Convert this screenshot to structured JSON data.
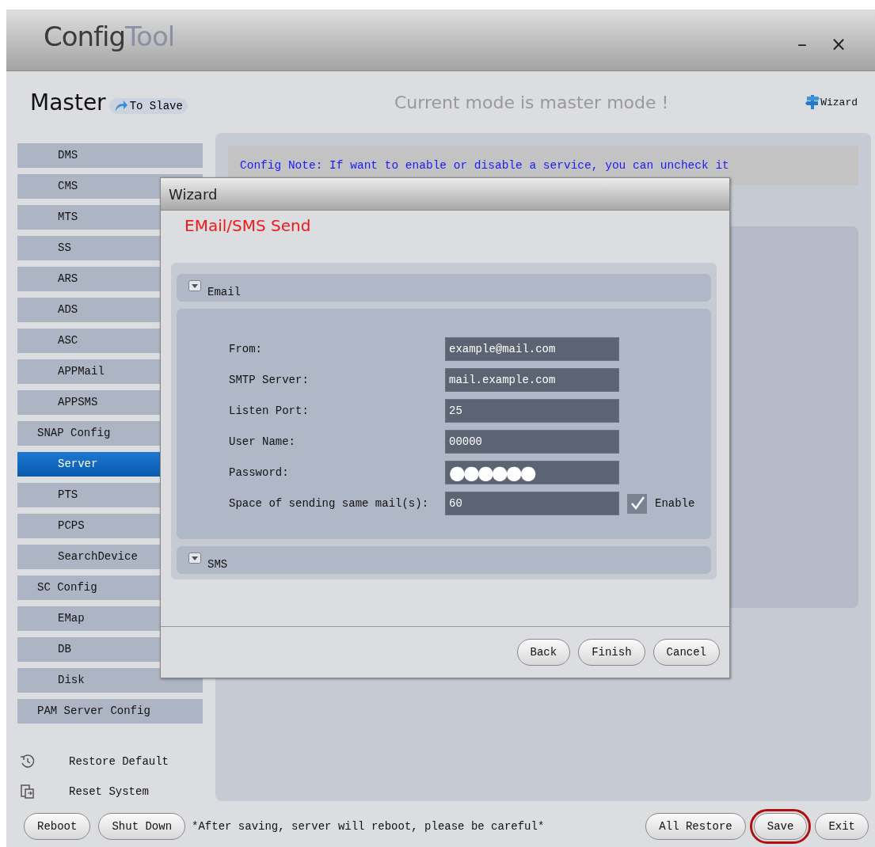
{
  "window": {
    "title_main": "Config",
    "title_accent": "Tool",
    "controls": [
      "–",
      "×"
    ]
  },
  "header": {
    "mode": "Master",
    "switch_button": "To Slave",
    "message": "Current mode is master mode !",
    "wizard_link": "Wizard"
  },
  "sidebar": {
    "groups": [
      {
        "children": [
          {
            "label": "DMS",
            "selected": false
          },
          {
            "label": "CMS",
            "selected": false
          },
          {
            "label": "MTS",
            "selected": false
          },
          {
            "label": "SS",
            "selected": false
          },
          {
            "label": "ARS",
            "selected": false
          },
          {
            "label": "ADS",
            "selected": false
          },
          {
            "label": "ASC",
            "selected": false
          },
          {
            "label": "APPMail",
            "selected": false
          },
          {
            "label": "APPSMS",
            "selected": false
          }
        ]
      },
      {
        "label": "SNAP Config",
        "children": [
          {
            "label": "Server",
            "selected": true
          },
          {
            "label": "PTS",
            "selected": false
          },
          {
            "label": "PCPS",
            "selected": false
          },
          {
            "label": "SearchDevice",
            "selected": false
          }
        ]
      },
      {
        "label": "SC Config",
        "children": [
          {
            "label": "EMap",
            "selected": false
          },
          {
            "label": "DB",
            "selected": false
          },
          {
            "label": "Disk",
            "selected": false
          }
        ]
      },
      {
        "label": "PAM Server Config"
      }
    ],
    "actions": [
      {
        "kind": "restore",
        "label": "Restore Default"
      },
      {
        "kind": "reset",
        "label": "Reset System"
      }
    ]
  },
  "main": {
    "note": "Config Note: If want to enable or disable a service, you can uncheck it"
  },
  "dialog": {
    "title": "Wizard",
    "heading": "EMail/SMS Send",
    "sections": [
      {
        "title": "Email",
        "fields": [
          {
            "label": "From:",
            "value": "example@mail.com",
            "kind": "text"
          },
          {
            "label": "SMTP Server:",
            "value": "mail.example.com",
            "kind": "text"
          },
          {
            "label": "Listen Port:",
            "value": "25",
            "kind": "text"
          },
          {
            "label": "User Name:",
            "value": "00000",
            "kind": "text"
          },
          {
            "label": "Password:",
            "value": "●●●●●●",
            "kind": "password"
          },
          {
            "label": "Space of sending same mail(s):",
            "value": "60",
            "kind": "text",
            "checkbox": {
              "label": "Enable",
              "checked": true
            }
          }
        ]
      },
      {
        "title": "SMS"
      }
    ],
    "buttons": [
      "Back",
      "Finish",
      "Cancel"
    ]
  },
  "footer": {
    "left_buttons": [
      {
        "label": "Reboot",
        "highlighted": false
      },
      {
        "label": "Shut Down",
        "highlighted": false
      }
    ],
    "warning": "*After saving, server will reboot, please be careful*",
    "right_buttons": [
      {
        "label": "All Restore",
        "highlighted": false
      },
      {
        "label": "Save",
        "highlighted": true
      },
      {
        "label": "Exit",
        "highlighted": false
      }
    ]
  }
}
